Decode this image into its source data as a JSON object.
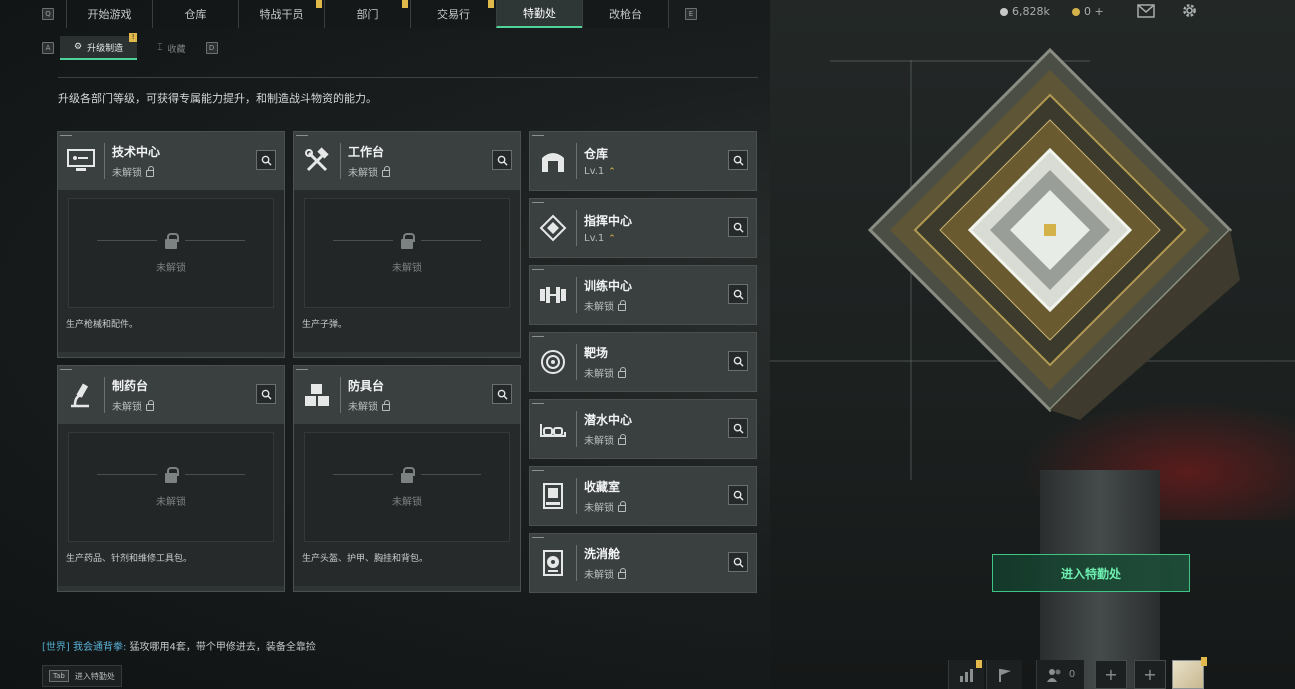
{
  "nav": {
    "key_left": "Q",
    "key_right": "E",
    "tabs": [
      {
        "label": "开始游戏",
        "alert": false
      },
      {
        "label": "仓库",
        "alert": false
      },
      {
        "label": "特战干员",
        "alert": true
      },
      {
        "label": "部门",
        "alert": true
      },
      {
        "label": "交易行",
        "alert": true
      },
      {
        "label": "特勤处",
        "alert": false,
        "active": true
      },
      {
        "label": "改枪台",
        "alert": false
      }
    ],
    "currency_silver": "6,828k",
    "currency_gold": "0 +"
  },
  "subnav": {
    "key_left": "A",
    "key_right": "D",
    "upgrade_label": "升级制造",
    "upgrade_badge": "!",
    "collect_label": "收藏"
  },
  "description": "升级各部门等级，可获得专属能力提升，和制造战斗物资的能力。",
  "production": [
    {
      "name": "技术中心",
      "status": "未解锁",
      "locked_text": "未解锁",
      "desc": "生产枪械和配件。",
      "icon": "computer-icon"
    },
    {
      "name": "工作台",
      "status": "未解锁",
      "locked_text": "未解锁",
      "desc": "生产子弹。",
      "icon": "hammer-wrench-icon"
    },
    {
      "name": "制药台",
      "status": "未解锁",
      "locked_text": "未解锁",
      "desc": "生产药品、针剂和维修工具包。",
      "icon": "microscope-icon"
    },
    {
      "name": "防具台",
      "status": "未解锁",
      "locked_text": "未解锁",
      "desc": "生产头盔、护甲、胸挂和背包。",
      "icon": "cubes-icon"
    }
  ],
  "facilities": [
    {
      "name": "仓库",
      "status": "Lv.1",
      "upgradable": true,
      "icon": "warehouse-icon"
    },
    {
      "name": "指挥中心",
      "status": "Lv.1",
      "upgradable": true,
      "icon": "command-diamond-icon"
    },
    {
      "name": "训练中心",
      "status": "未解锁",
      "upgradable": false,
      "icon": "dumbbell-icon"
    },
    {
      "name": "靶场",
      "status": "未解锁",
      "upgradable": false,
      "icon": "target-icon"
    },
    {
      "name": "潜水中心",
      "status": "未解锁",
      "upgradable": false,
      "icon": "goggles-icon"
    },
    {
      "name": "收藏室",
      "status": "未解锁",
      "upgradable": false,
      "icon": "display-case-icon"
    },
    {
      "name": "洗消舱",
      "status": "未解锁",
      "upgradable": false,
      "icon": "radiation-icon"
    }
  ],
  "enter_button": "进入特勤处",
  "chat": {
    "channel": "[世界]",
    "sender": "我会通背拳:",
    "message": "猛攻哪用4套，带个甲修进去，装备全靠捡"
  },
  "tab_hint": {
    "key": "Tab",
    "label": "进入特勤处"
  },
  "bottom": {
    "friends_count": "0"
  },
  "colors": {
    "accent": "#4fd39a",
    "alert": "#e0b94a",
    "panel": "#3a3f3f"
  }
}
